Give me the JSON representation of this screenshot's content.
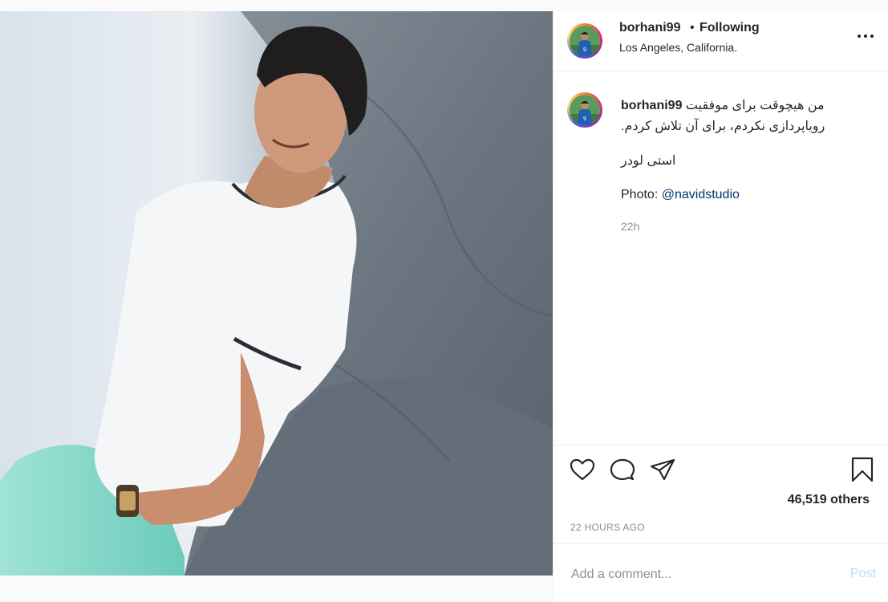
{
  "header": {
    "username": "borhani99",
    "separator": "•",
    "follow_status": "Following",
    "location": "Los Angeles, California."
  },
  "caption": {
    "username": "borhani99",
    "line1": "من هیچوقت برای موفقیت",
    "line2": "رویاپردازی نکردم، برای آن تلاش کردم.",
    "line3": "استی لودر",
    "photo_label": "Photo:",
    "photo_mention": "@navidstudio",
    "time": "22h"
  },
  "stats": {
    "likes": "46,519 others",
    "posted": "22 HOURS AGO"
  },
  "comment": {
    "placeholder": "Add a comment...",
    "post_label": "Post"
  },
  "colors": {
    "link": "#00376b",
    "muted": "#8e8e8e",
    "post_button_disabled": "#b2dffc"
  },
  "icons": [
    "more-options-icon",
    "heart-icon",
    "comment-icon",
    "share-icon",
    "bookmark-icon"
  ]
}
